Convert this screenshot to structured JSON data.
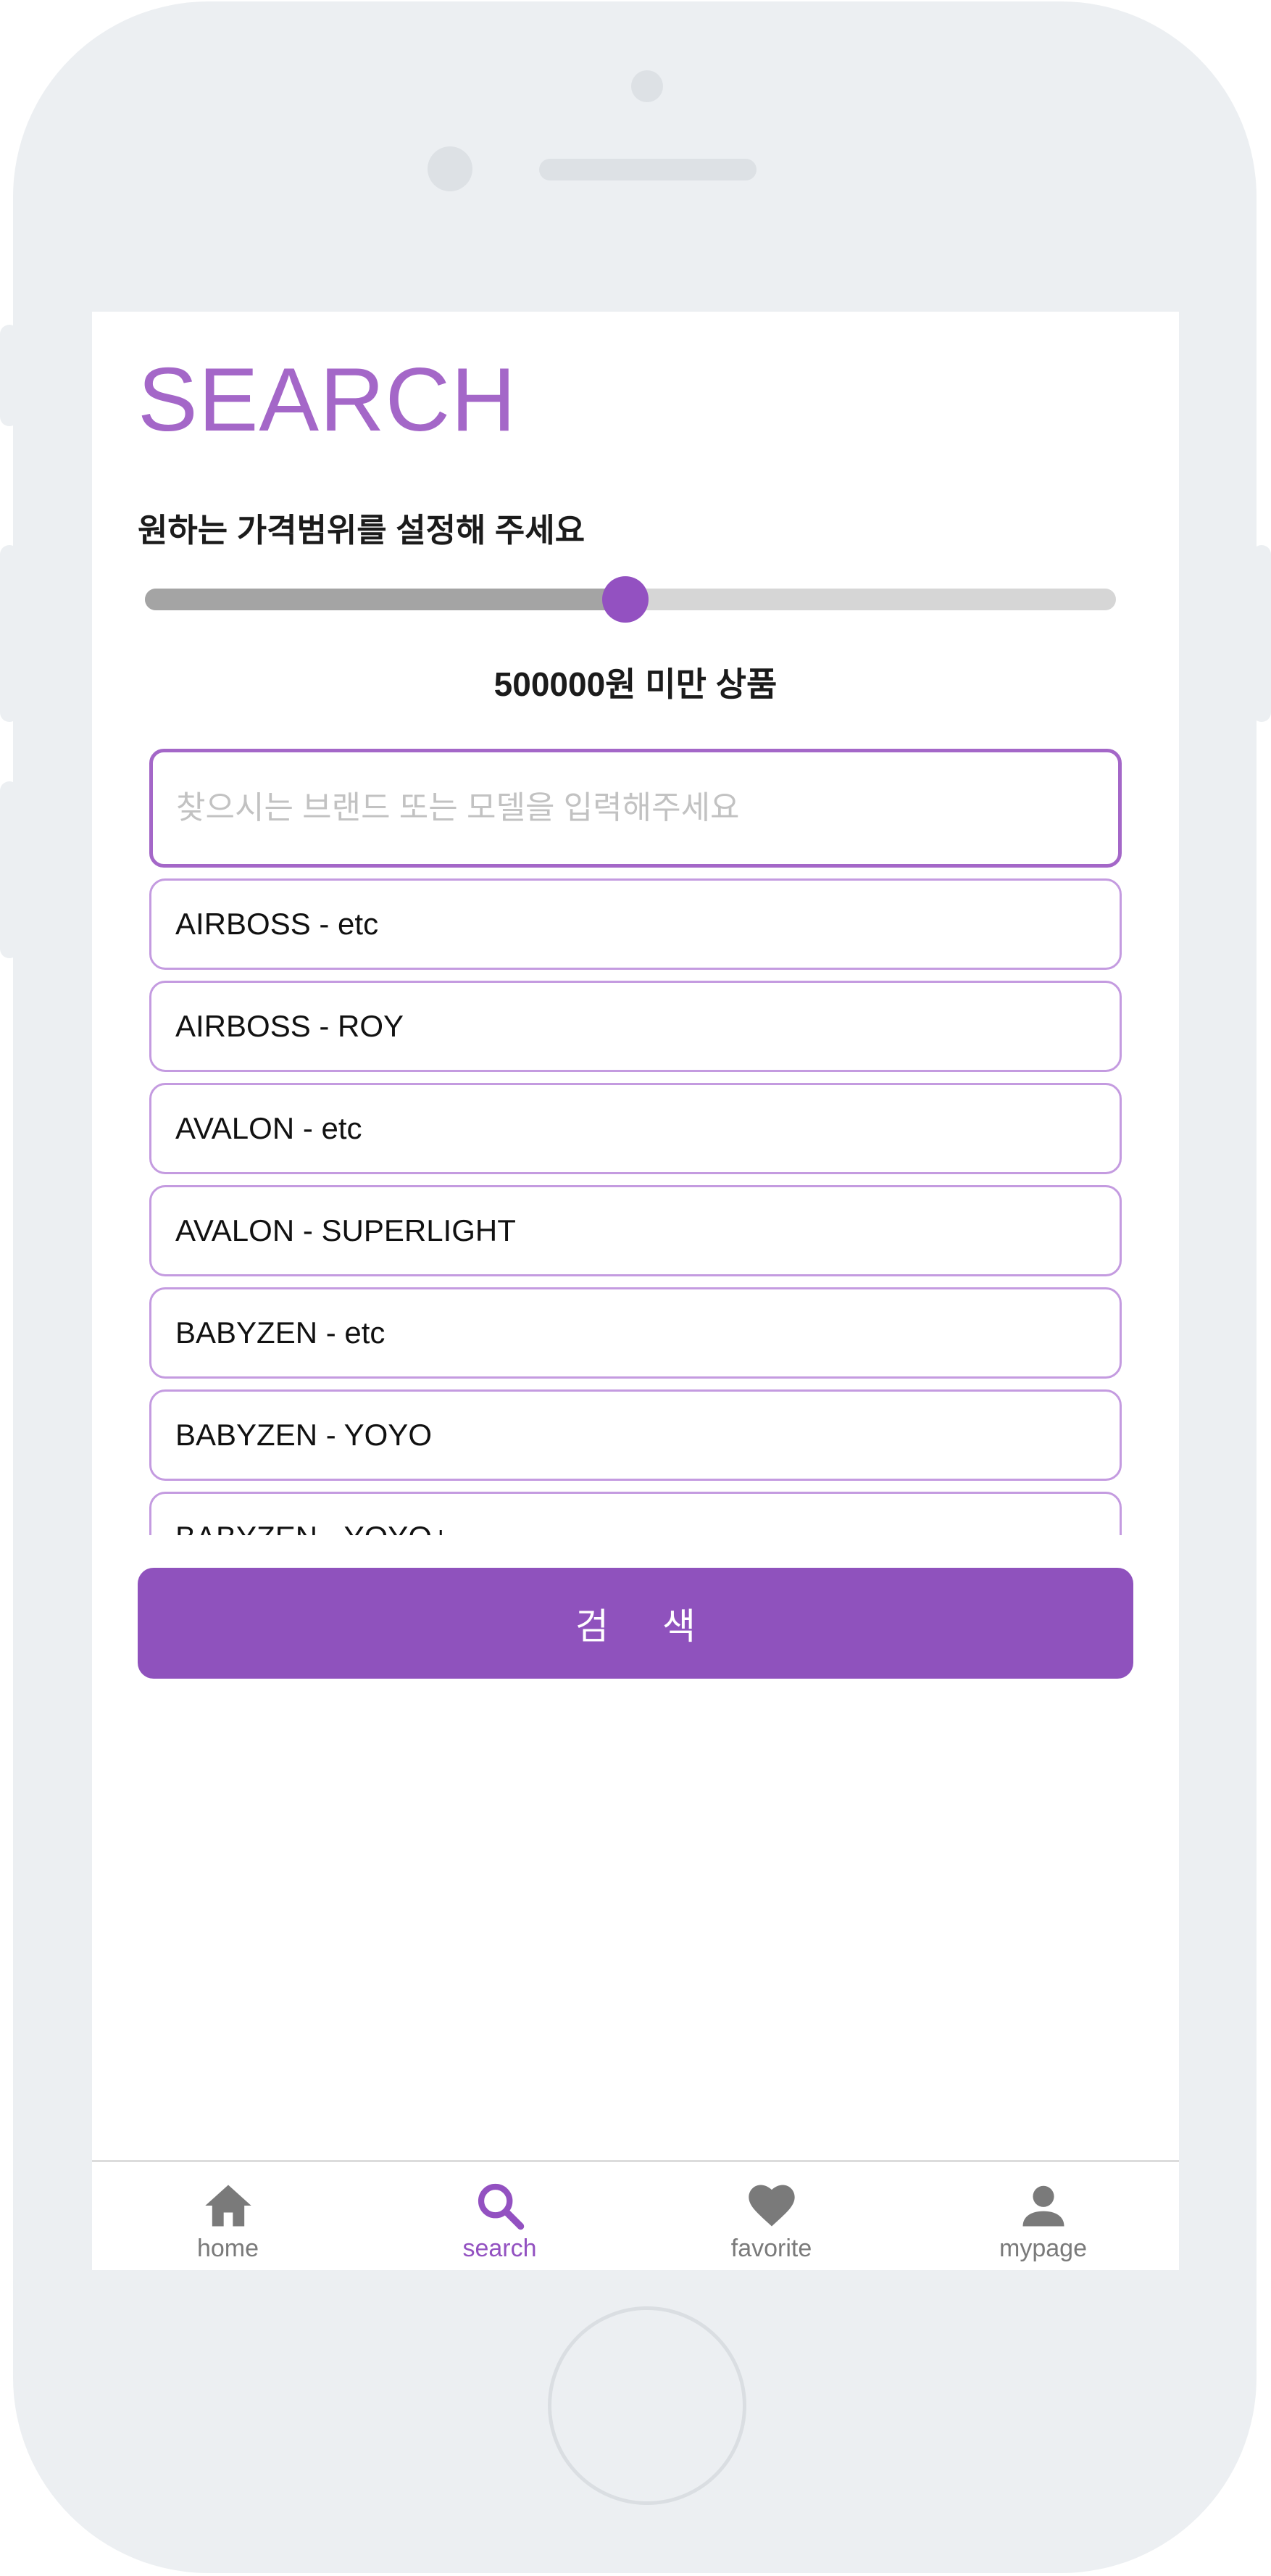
{
  "header": {
    "title": "SEARCH"
  },
  "price_filter": {
    "instruction": "원하는 가격범위를 설정해 주세요",
    "slider_fraction": 0.495,
    "value_label": "500000원 미만 상품"
  },
  "search": {
    "placeholder": "찾으시는 브랜드 또는 모델을 입력해주세요",
    "value": ""
  },
  "suggestions": [
    {
      "label": "AIRBOSS - etc"
    },
    {
      "label": "AIRBOSS - ROY"
    },
    {
      "label": "AVALON - etc"
    },
    {
      "label": "AVALON - SUPERLIGHT"
    },
    {
      "label": "BABYZEN - etc"
    },
    {
      "label": "BABYZEN - YOYO"
    },
    {
      "label": "BABYZEN - YOYO+"
    }
  ],
  "submit": {
    "label": "검 색"
  },
  "tabbar": {
    "tabs": [
      {
        "label": "home",
        "icon": "home-icon"
      },
      {
        "label": "search",
        "icon": "search-icon",
        "active": true
      },
      {
        "label": "favorite",
        "icon": "heart-icon"
      },
      {
        "label": "mypage",
        "icon": "person-icon"
      }
    ]
  },
  "colors": {
    "accent": "#9351c1",
    "title": "#a467c8",
    "tab_inactive": "#7a7a7a",
    "frame": "#eceff2"
  }
}
